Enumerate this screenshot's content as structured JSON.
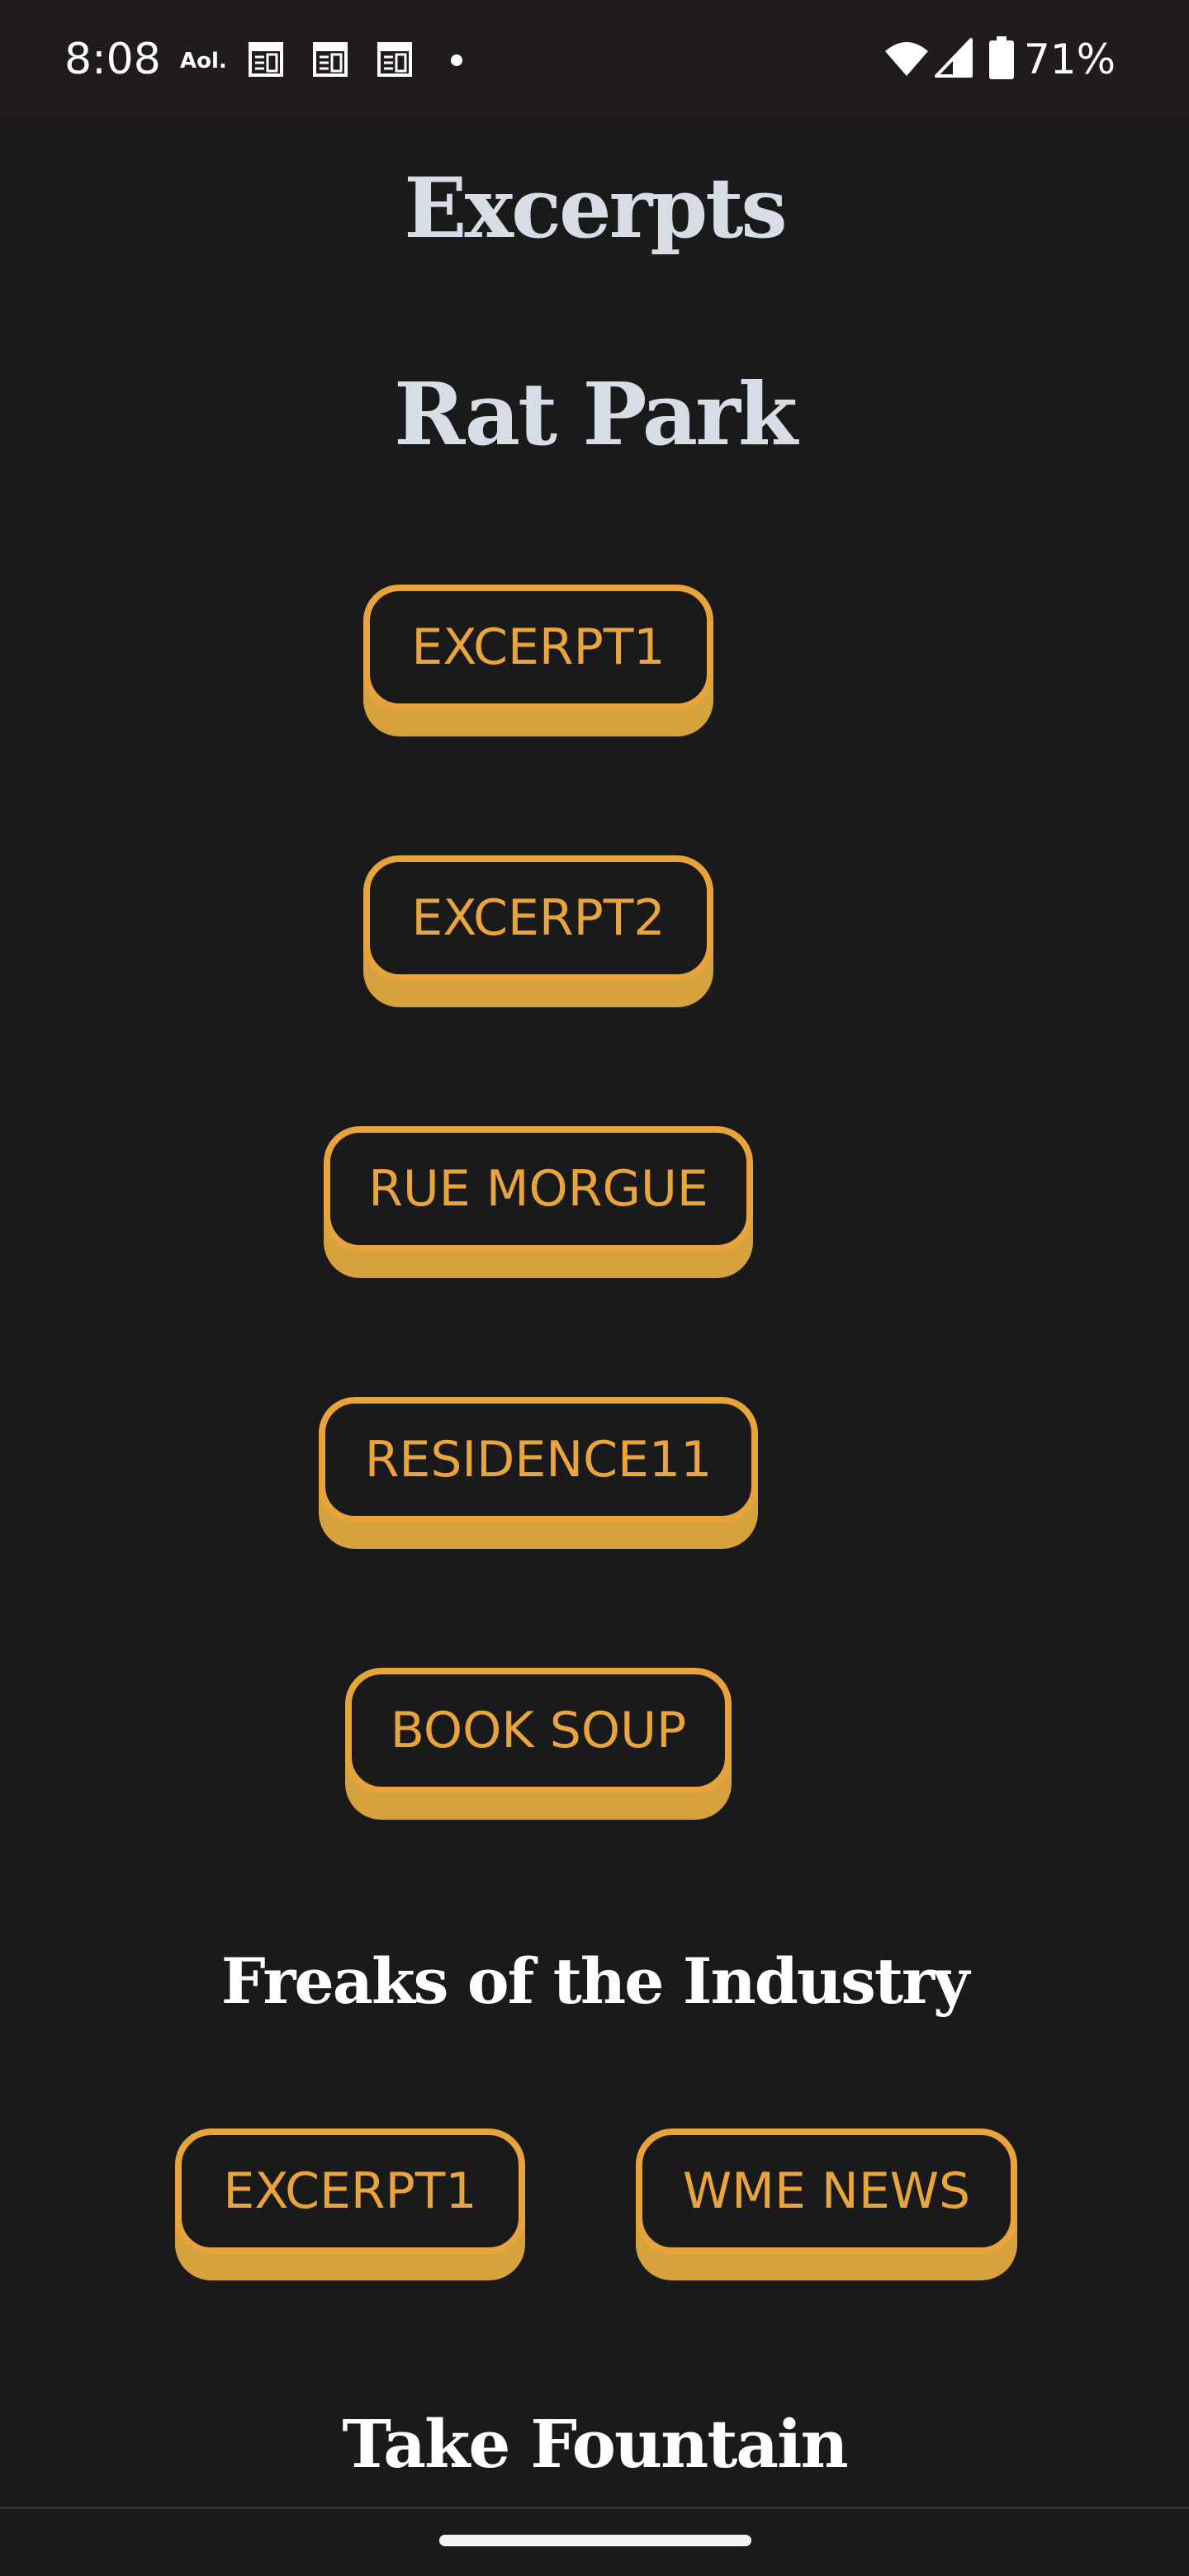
{
  "status_bar": {
    "time": "8:08",
    "aol_label": "Aol.",
    "battery_percent": "71%",
    "icons": [
      "news-icon",
      "news-icon",
      "news-icon",
      "notification-dot",
      "wifi-icon",
      "signal-icon",
      "battery-icon"
    ]
  },
  "page": {
    "title": "Excerpts"
  },
  "sections": {
    "rat_park": {
      "title": "Rat Park",
      "buttons": [
        "EXCERPT1",
        "EXCERPT2",
        "RUE MORGUE",
        "RESIDENCE11",
        "BOOK SOUP"
      ]
    },
    "freaks": {
      "title": "Freaks of the Industry",
      "buttons": [
        "EXCERPT1",
        "WME NEWS"
      ]
    },
    "take_fountain": {
      "title": "Take Fountain"
    }
  },
  "colors": {
    "background": "#1b1a1a",
    "accent": "#e8a33a",
    "button_shadow": "#d6a23e",
    "heading_light": "#d6dde6"
  }
}
